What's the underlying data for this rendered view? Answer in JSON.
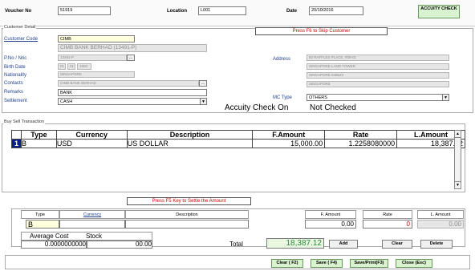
{
  "header": {
    "voucher_label": "Voucher No",
    "voucher_value": "51919",
    "location_label": "Location",
    "location_value": "L001",
    "date_label": "Date",
    "date_value": "20/10/2016",
    "accuity_button": "ACCUITY CHECK"
  },
  "customer": {
    "section_title": "Customer Detail",
    "f6_message": "Press F6 to Skip Customer",
    "customer_code_label": "Customer Code",
    "customer_code_value": "CIMB",
    "customer_name": "CIMB BANK BERHAD (13491-P)",
    "pno_label": "P.No / Nric",
    "pno_value": "13491-P",
    "birth_label": "Birth Date",
    "birth_day": "01",
    "birth_month": "01",
    "birth_year": "1900",
    "nationality_label": "Nationality",
    "nationality_value": "SINGAPORE",
    "contacts_label": "Contacts",
    "contacts_value": "CIMB BANK BERHAD",
    "remarks_label": "Remarks",
    "remarks_value": "BANK",
    "settlement_label": "Settlement",
    "settlement_value": "CASH",
    "address_label": "Address",
    "address_lines": [
      "50 RAFFLES PLACE, #09-01",
      "SINGAPORE LAND TOWER",
      "SINGAPORE 048623",
      "SINGAPORE"
    ],
    "mc_type_label": "MC Type",
    "mc_type_value": "OTHERS",
    "accuity_status_label": "Accuity Check On",
    "accuity_status_value": "Not Checked"
  },
  "transaction": {
    "section_title": "Buy Sell Transaction",
    "columns": [
      "Type",
      "Currency",
      "Description",
      "F.Amount",
      "Rate",
      "L.Amount"
    ],
    "rows": [
      {
        "no": "1",
        "type": "B",
        "currency": "USD",
        "description": "US DOLLAR",
        "f_amount": "15,000.00",
        "rate": "1.2258080000",
        "l_amount": "18,387.12"
      }
    ],
    "f5_message": "Press F5 Key to Settle the Amount"
  },
  "entry": {
    "type_label": "Type",
    "currency_label": "Currency",
    "description_label": "Description",
    "famount_label": "F. Amount",
    "rate_label": "Rate",
    "lamount_label": "L. Amount",
    "type_value": "B",
    "famount_value": "0.00",
    "rate_value": "0",
    "lamount_value": "0.00",
    "avg_cost_label": "Average Cost",
    "avg_cost_value": "0.0000000000",
    "stock_label": "Stock",
    "stock_value": "00.00",
    "total_label": "Total",
    "total_value": "18,387.12",
    "add_button": "Add",
    "clear_button": "Clear",
    "delete_button": "Delete"
  },
  "footer": {
    "clear_f2": "Clear ( F2)",
    "save_f4": "Save ( F4)",
    "save_print_f3": "Save/Print(F3)",
    "close_esc": "Close (Esc)"
  }
}
